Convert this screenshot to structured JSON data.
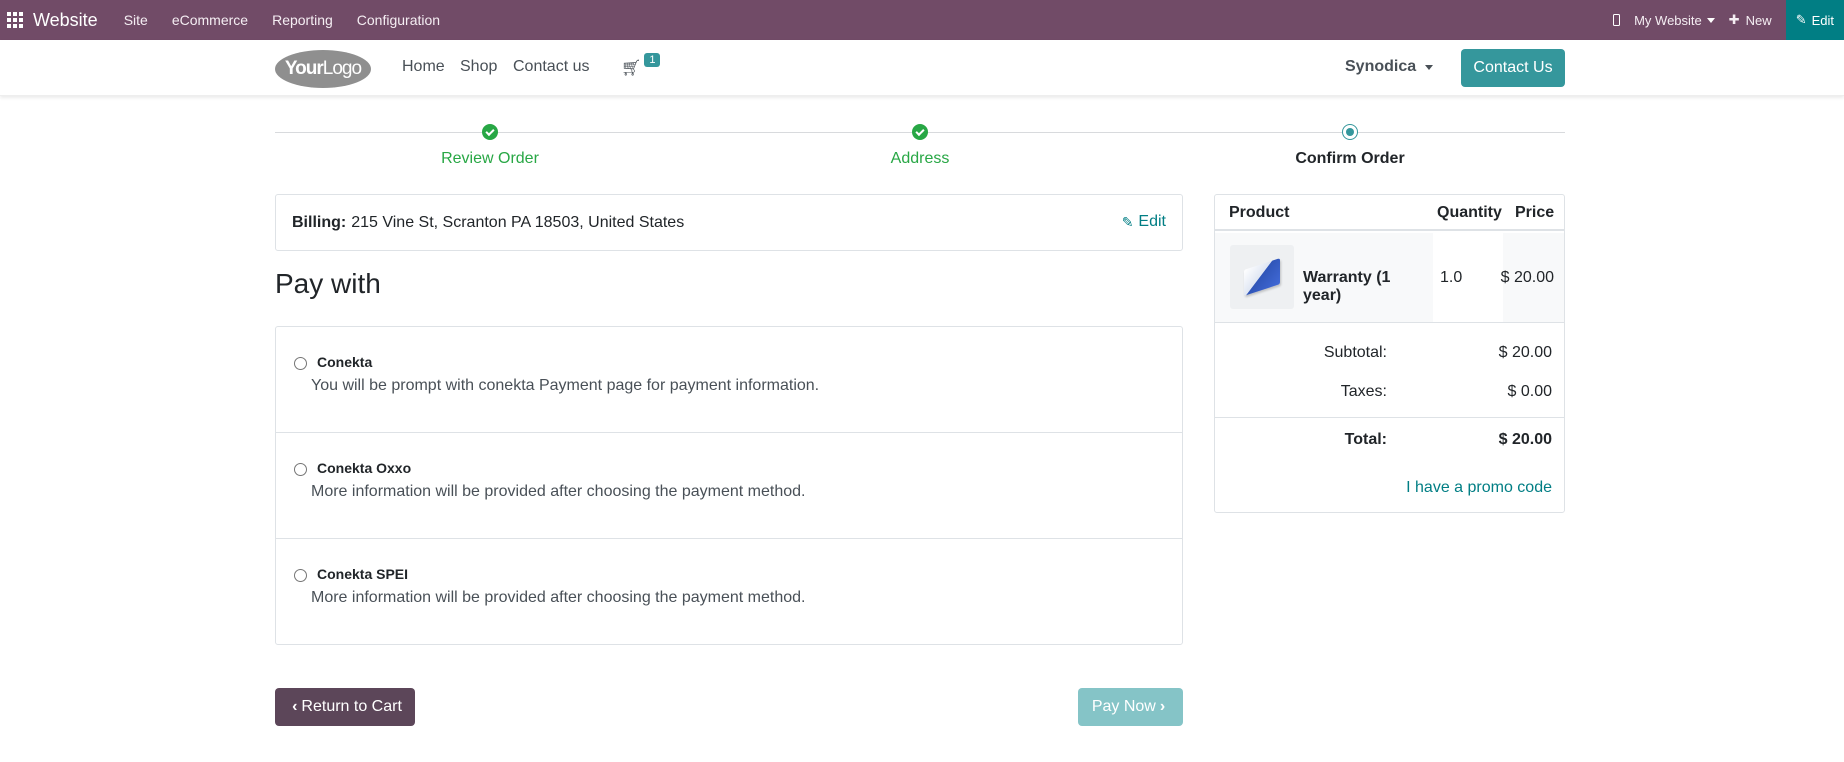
{
  "topbar": {
    "brand": "Website",
    "menu": [
      "Site",
      "eCommerce",
      "Reporting",
      "Configuration"
    ],
    "my_website": "My Website",
    "new_label": "New",
    "edit_label": "Edit",
    "bg_color": "#714b67",
    "edit_color": "#017e84"
  },
  "header": {
    "logo_text_bold": "Your",
    "logo_text_thin": "Logo",
    "nav": [
      "Home",
      "Shop",
      "Contact us"
    ],
    "cart_count": "1",
    "company": "Synodica",
    "contact_button": "Contact Us",
    "accent_color": "#35979c"
  },
  "wizard": {
    "steps": [
      {
        "label": "Review Order",
        "state": "done"
      },
      {
        "label": "Address",
        "state": "done"
      },
      {
        "label": "Confirm Order",
        "state": "current"
      }
    ]
  },
  "billing": {
    "label": "Billing:",
    "address": "215 Vine St, Scranton PA 18503, United States",
    "edit_label": "Edit"
  },
  "pay_with": {
    "title": "Pay with",
    "options": [
      {
        "name": "Conekta",
        "description": "You will be prompt with conekta Payment page for payment information."
      },
      {
        "name": "Conekta Oxxo",
        "description": "More information will be provided after choosing the payment method."
      },
      {
        "name": "Conekta SPEI",
        "description": "More information will be provided after choosing the payment method."
      }
    ]
  },
  "buttons": {
    "return_to_cart": "Return to Cart",
    "pay_now": "Pay Now"
  },
  "summary": {
    "headers": {
      "product": "Product",
      "quantity": "Quantity",
      "price": "Price"
    },
    "items": [
      {
        "name": "Warranty (1 year)",
        "quantity": "1.0",
        "price": "$ 20.00"
      }
    ],
    "subtotal_label": "Subtotal:",
    "subtotal": "$ 20.00",
    "taxes_label": "Taxes:",
    "taxes": "$ 0.00",
    "total_label": "Total:",
    "total": "$ 20.00",
    "promo": "I have a promo code"
  }
}
